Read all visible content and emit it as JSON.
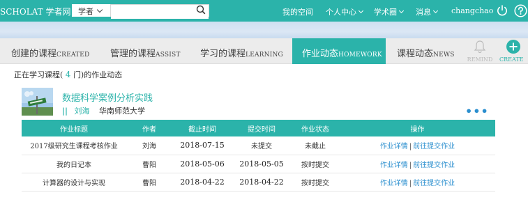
{
  "topbar": {
    "brand": "SCHOLAT 学者网",
    "search_type": "学者",
    "search_value": "",
    "nav": [
      {
        "label": "我的空间",
        "has_dropdown": false
      },
      {
        "label": "个人中心",
        "has_dropdown": true
      },
      {
        "label": "学术圈",
        "has_dropdown": true
      },
      {
        "label": "消息",
        "has_dropdown": true
      }
    ],
    "username": "changchao",
    "colors": {
      "accent": "#2bb3aa",
      "link": "#2b8fcf"
    }
  },
  "tabs": [
    {
      "zh": "创建的课程",
      "en": "CREATED",
      "active": false
    },
    {
      "zh": "管理的课程",
      "en": "ASSIST",
      "active": false
    },
    {
      "zh": "学习的课程",
      "en": "LEARNING",
      "active": false
    },
    {
      "zh": "作业动态",
      "en": "HOMEWORK",
      "active": true
    },
    {
      "zh": "课程动态",
      "en": "NEWS",
      "active": false
    }
  ],
  "remind_label": "REMIND",
  "create_label": "CREATE",
  "intro": {
    "prefix": "正在学习课程(",
    "count": "4",
    "suffix": "门)的作业动态"
  },
  "course": {
    "title": "数据科学案例分析实践",
    "teacher": "刘海",
    "school": "华南师范大学"
  },
  "table": {
    "headers": [
      "作业标题",
      "作者",
      "截止时间",
      "提交时间",
      "作业状态",
      "操作"
    ],
    "rows": [
      {
        "title": "2017级研究生课程考核作业",
        "author": "刘海",
        "deadline": "2018-07-15",
        "submitted": "未提交",
        "status": "未截止",
        "submitted_style": "red",
        "status_style": "green"
      },
      {
        "title": "我的日记本",
        "author": "曹阳",
        "deadline": "2018-05-06",
        "submitted": "2018-05-05",
        "status": "按时提交",
        "submitted_style": "date",
        "status_style": "green"
      },
      {
        "title": "计算器的设计与实现",
        "author": "曹阳",
        "deadline": "2018-04-22",
        "submitted": "2018-04-22",
        "status": "按时提交",
        "submitted_style": "date",
        "status_style": "green"
      }
    ],
    "op_detail": "作业详情",
    "op_sep": "|",
    "op_submit": "前往提交作业"
  }
}
